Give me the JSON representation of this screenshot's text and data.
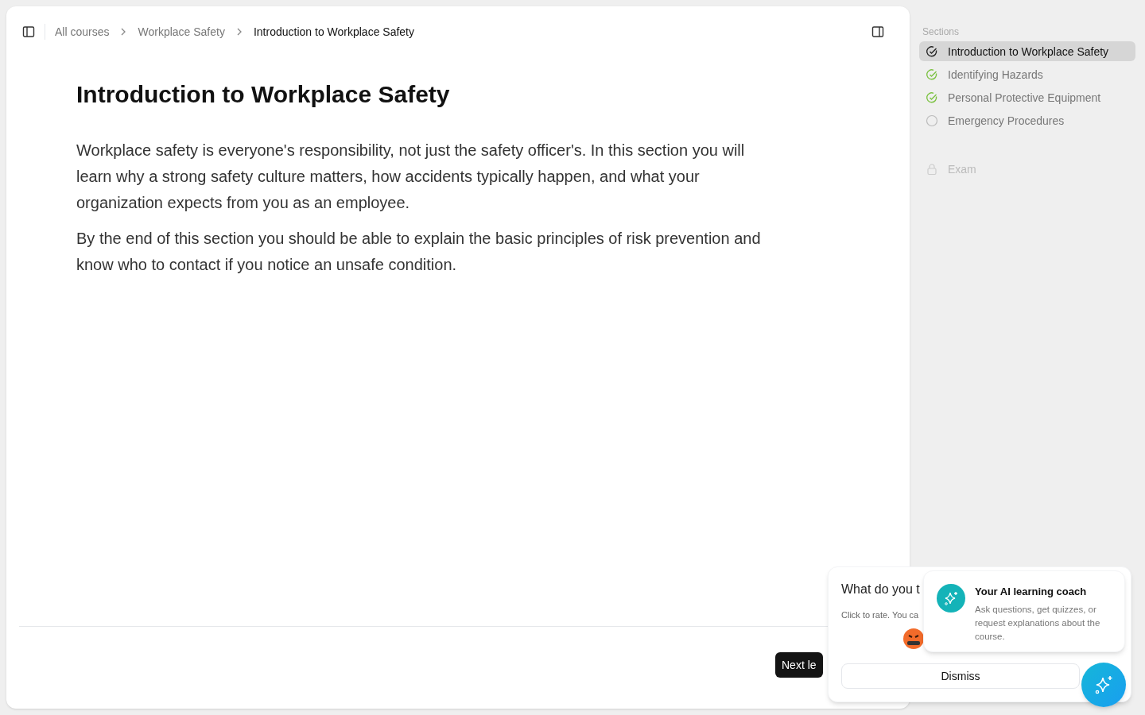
{
  "breadcrumb": [
    {
      "label": "All courses",
      "current": false
    },
    {
      "label": "Workplace Safety",
      "current": false
    },
    {
      "label": "Introduction to Workplace Safety",
      "current": true
    }
  ],
  "lesson": {
    "title": "Introduction to Workplace Safety",
    "paragraphs": [
      "Workplace safety is everyone's responsibility, not just the safety officer's. In this section you will learn why a strong safety culture matters, how accidents typically happen, and what your organization expects from you as an employee.",
      "By the end of this section you should be able to explain the basic principles of risk prevention and know who to contact if you notice an unsafe condition."
    ]
  },
  "next_button": "Next le",
  "sidebar": {
    "heading": "Sections",
    "items": [
      {
        "label": "Introduction to Workplace Safety",
        "kind": "done",
        "selected": true
      },
      {
        "label": "Identifying Hazards",
        "kind": "done",
        "selected": false
      },
      {
        "label": "Personal Protective Equipment",
        "kind": "done",
        "selected": false
      },
      {
        "label": "Emergency Procedures",
        "kind": "todo",
        "selected": false
      },
      {
        "label": "Exam",
        "kind": "locked",
        "selected": false
      }
    ]
  },
  "feedback": {
    "title": "What do you t",
    "hint": "Click to rate. You ca",
    "dismiss": "Dismiss"
  },
  "coach": {
    "title": "Your AI learning coach",
    "text": "Ask questions, get quizzes, or request explanations about the course."
  }
}
